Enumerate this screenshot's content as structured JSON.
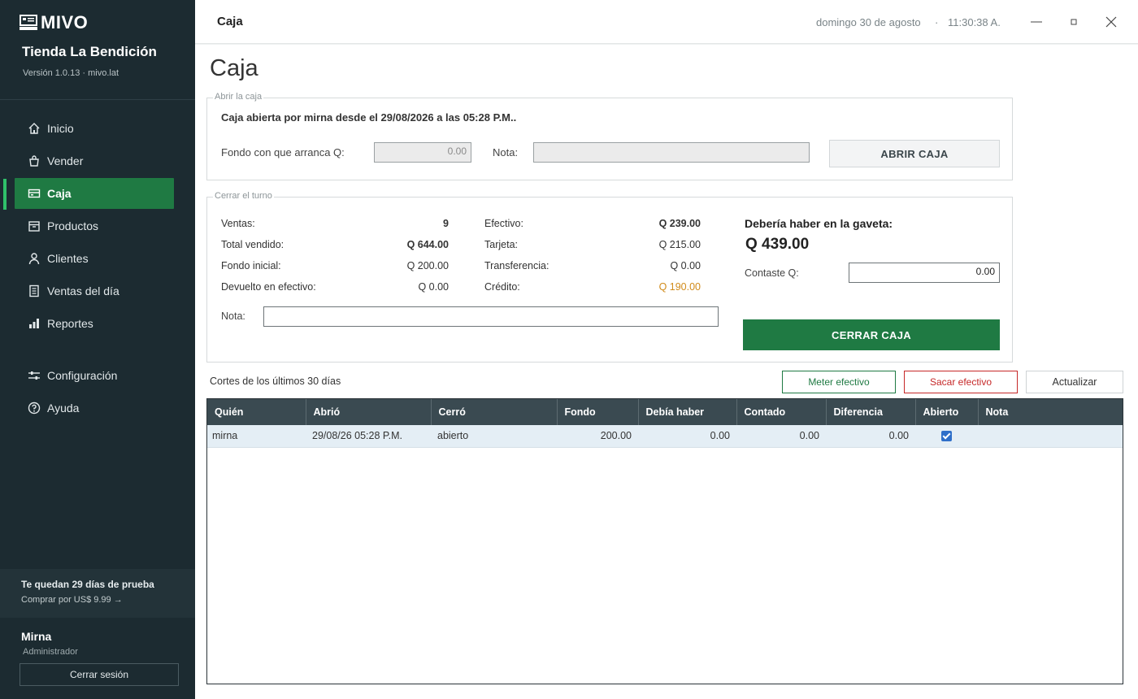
{
  "sidebar": {
    "brand": "MIVO",
    "store_name": "Tienda La Bendición",
    "version": "Versión 1.0.13 · mivo.lat",
    "items": [
      {
        "label": "Inicio",
        "icon": "home-icon"
      },
      {
        "label": "Vender",
        "icon": "bag-icon"
      },
      {
        "label": "Caja",
        "icon": "cash-register-icon",
        "active": true
      },
      {
        "label": "Productos",
        "icon": "box-icon"
      },
      {
        "label": "Clientes",
        "icon": "person-icon"
      },
      {
        "label": "Ventas del día",
        "icon": "receipt-icon"
      },
      {
        "label": "Reportes",
        "icon": "bar-chart-icon"
      },
      {
        "label": "Configuración",
        "icon": "sliders-icon"
      },
      {
        "label": "Ayuda",
        "icon": "help-icon"
      }
    ],
    "trial_title": "Te quedan 29 días de prueba",
    "trial_link": "Comprar por US$ 9.99 →",
    "user_name": "Mirna",
    "user_role": "Administrador",
    "logout_label": "Cerrar sesión"
  },
  "topbar": {
    "title": "Caja",
    "date": "domingo 30 de agosto",
    "separator": "·",
    "time": "11:30:38 A."
  },
  "page": {
    "title": "Caja"
  },
  "open_box": {
    "legend": "Abrir la caja",
    "status_message": "Caja abierta por mirna desde el 29/08/2026 a las 05:28 P.M..",
    "fund_label": "Fondo con que arranca Q:",
    "fund_value": "0.00",
    "note_label": "Nota:",
    "note_value": "",
    "open_button": "ABRIR CAJA"
  },
  "close_shift": {
    "legend": "Cerrar el turno",
    "ventas_label": "Ventas:",
    "ventas_value": "9",
    "total_label": "Total vendido:",
    "total_value": "Q 644.00",
    "fondo_label": "Fondo inicial:",
    "fondo_value": "Q 200.00",
    "devuelto_label": "Devuelto en efectivo:",
    "devuelto_value": "Q 0.00",
    "efectivo_label": "Efectivo:",
    "efectivo_value": "Q 239.00",
    "tarjeta_label": "Tarjeta:",
    "tarjeta_value": "Q 215.00",
    "transferencia_label": "Transferencia:",
    "transferencia_value": "Q 0.00",
    "credito_label": "Crédito:",
    "credito_value": "Q 190.00",
    "credito_color": "#d18b1a",
    "expected_label": "Debería haber en la gaveta:",
    "expected_value": "Q 439.00",
    "counted_label": "Contaste Q:",
    "counted_value": "0.00",
    "note_label": "Nota:",
    "note_value": "",
    "close_button": "CERRAR CAJA"
  },
  "cuts": {
    "title": "Cortes de los últimos 30 días",
    "deposit_button": "Meter efectivo",
    "withdraw_button": "Sacar efectivo",
    "refresh_button": "Actualizar",
    "columns": [
      "Quién",
      "Abrió",
      "Cerró",
      "Fondo",
      "Debía haber",
      "Contado",
      "Diferencia",
      "Abierto",
      "Nota"
    ],
    "rows": [
      {
        "quien": "mirna",
        "abrio": "29/08/26 05:28 P.M.",
        "cerro": "abierto",
        "fondo": "200.00",
        "debia": "0.00",
        "contado": "0.00",
        "diferencia": "0.00",
        "abierto": true,
        "nota": ""
      }
    ]
  },
  "colors": {
    "sidebar_bg": "#1c2b31",
    "accent_green": "#1f7a43",
    "danger_red": "#c62828",
    "table_header": "#3a4a51"
  }
}
